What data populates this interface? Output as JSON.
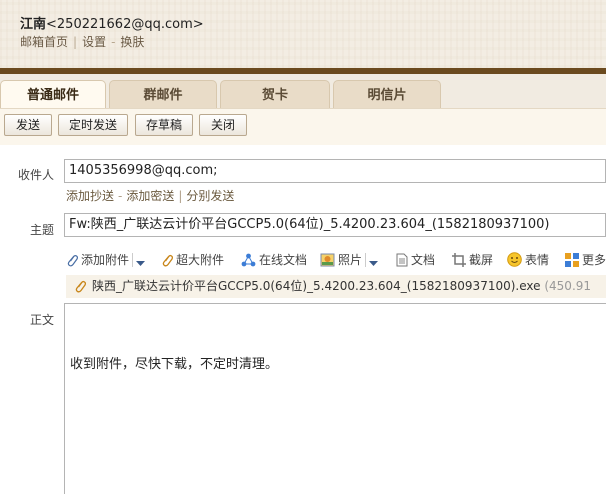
{
  "header": {
    "account_name": "江南",
    "account_email": "<250221662@qq.com>",
    "nav": [
      "邮箱首页",
      "设置",
      "换肤"
    ]
  },
  "tabs": [
    {
      "label": "普通邮件",
      "active": true
    },
    {
      "label": "群邮件",
      "active": false
    },
    {
      "label": "贺卡",
      "active": false
    },
    {
      "label": "明信片",
      "active": false
    }
  ],
  "toolbar": {
    "send": "发送",
    "schedule_send": "定时发送",
    "save_draft": "存草稿",
    "close": "关闭"
  },
  "compose": {
    "to_label": "收件人",
    "to_value": "1405356998@qq.com;",
    "add_cc": "添加抄送",
    "add_bcc": "添加密送",
    "separate_send": "分别发送",
    "subject_label": "主题",
    "subject_value": "Fw:陕西_广联达云计价平台GCCP5.0(64位)_5.4200.23.604_(1582180937100)",
    "body_label": "正文",
    "body_text": "收到附件，尽快下载，不定时清理。"
  },
  "attach_toolbar": {
    "add_attachment": "添加附件",
    "large_attachment": "超大附件",
    "online_doc": "在线文档",
    "photo": "照片",
    "document": "文档",
    "screenshot": "截屏",
    "emoji": "表情",
    "more": "更多"
  },
  "attachment": {
    "filename": "陕西_广联达云计价平台GCCP5.0(64位)_5.4200.23.604_(1582180937100).exe",
    "size": "(450.91"
  },
  "colors": {
    "header_bg": "#f3ede3",
    "brown_bar": "#6b4a1f",
    "tab_bg": "#e9dcc8",
    "link": "#6b5a3f"
  }
}
